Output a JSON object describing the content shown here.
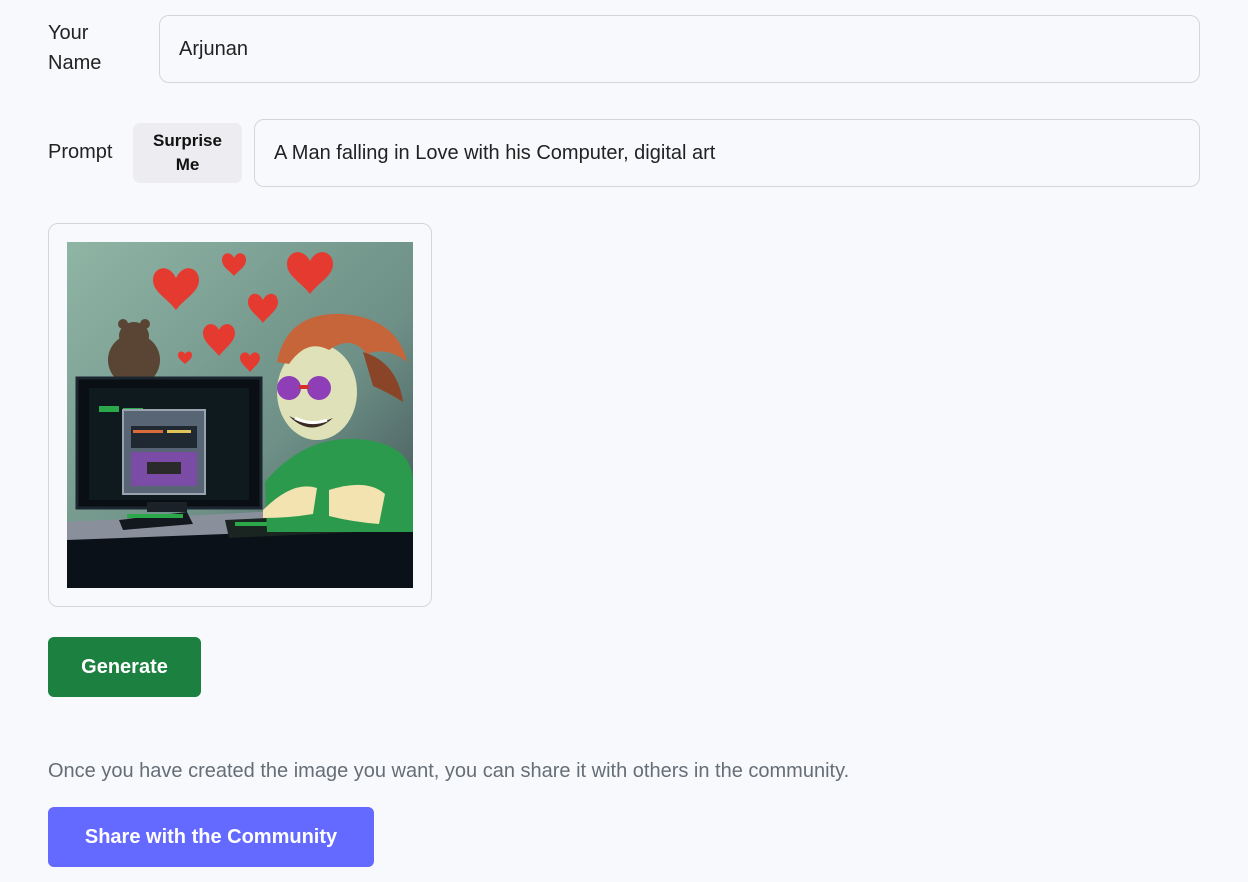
{
  "form": {
    "name_label": "Your Name",
    "name_value": "Arjunan",
    "prompt_label": "Prompt",
    "surprise_button_label": "Surprise Me",
    "prompt_value": "A Man falling in Love with his Computer, digital art"
  },
  "preview": {
    "icon": "generated-artwork"
  },
  "actions": {
    "generate_label": "Generate",
    "share_note": "Once you have created the image you want, you can share it with others in the community.",
    "share_label": "Share with the Community"
  },
  "colors": {
    "page_background": "#f8f9fd",
    "generate_button": "#1b8040",
    "share_button": "#6469ff",
    "surprise_button": "#ececf1"
  }
}
